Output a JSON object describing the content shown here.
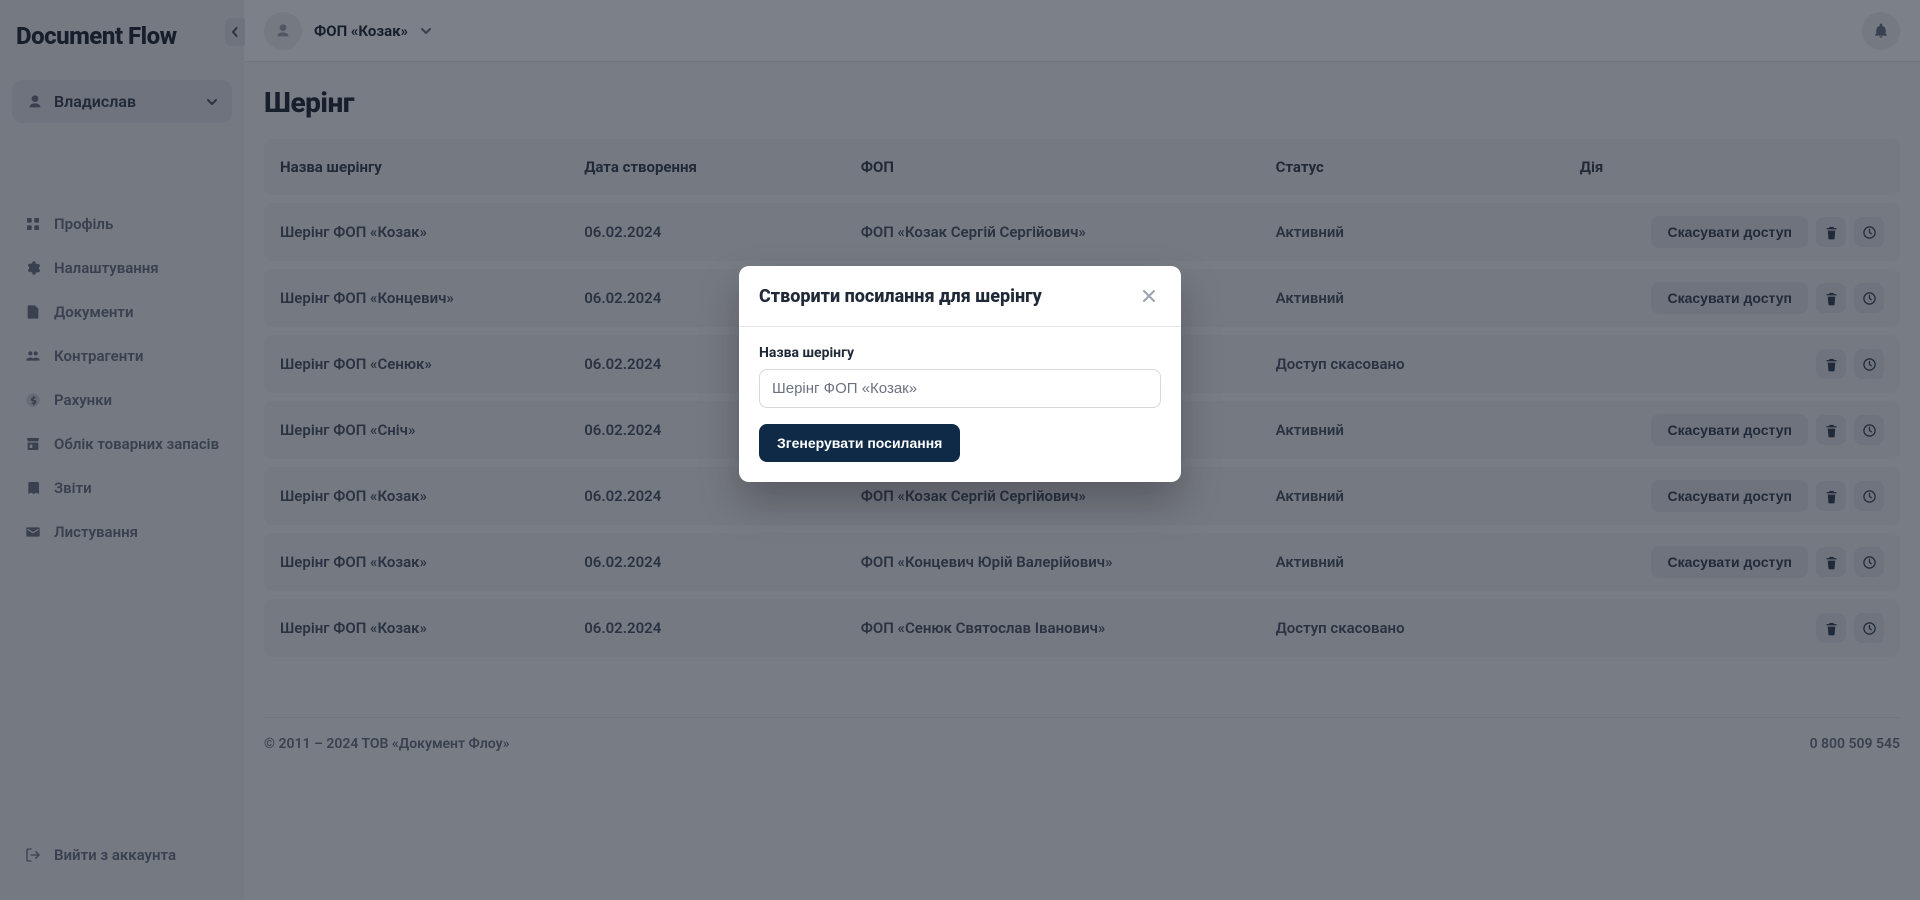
{
  "brand": "Document Flow",
  "user_switch": {
    "name": "Владислав"
  },
  "nav": {
    "items": [
      {
        "label": "Профіль"
      },
      {
        "label": "Налаштування"
      },
      {
        "label": "Документи"
      },
      {
        "label": "Контрагенти"
      },
      {
        "label": "Рахунки"
      },
      {
        "label": "Облік товарних запасів"
      },
      {
        "label": "Звіти"
      },
      {
        "label": "Листування"
      }
    ],
    "logout_label": "Вийти з аккаунта"
  },
  "topbar": {
    "org_name": "ФОП «Козак»"
  },
  "page": {
    "title": "Шерінг"
  },
  "table": {
    "headers": {
      "name": "Назва шерінгу",
      "date": "Дата створення",
      "fop": "ФОП",
      "status": "Статус",
      "action": "Дія"
    },
    "revoke_label": "Скасувати доступ",
    "rows": [
      {
        "name": "Шерінг ФОП «Козак»",
        "date": "06.02.2024",
        "fop": "ФОП «Козак Сергій Сергійович»",
        "status": "Активний",
        "revocable": true
      },
      {
        "name": "Шерінг ФОП «Концевич»",
        "date": "06.02.2024",
        "fop": "",
        "status": "Активний",
        "revocable": true
      },
      {
        "name": "Шерінг ФОП «Сенюк»",
        "date": "06.02.2024",
        "fop": "",
        "status": "Доступ скасовано",
        "revocable": false
      },
      {
        "name": "Шерінг ФОП «Сніч»",
        "date": "06.02.2024",
        "fop": "",
        "status": "Активний",
        "revocable": true
      },
      {
        "name": "Шерінг ФОП «Козак»",
        "date": "06.02.2024",
        "fop": "ФОП «Козак Сергій Сергійович»",
        "status": "Активний",
        "revocable": true
      },
      {
        "name": "Шерінг ФОП «Козак»",
        "date": "06.02.2024",
        "fop": "ФОП «Концевич Юрій Валерійович»",
        "status": "Активний",
        "revocable": true
      },
      {
        "name": "Шерінг ФОП «Козак»",
        "date": "06.02.2024",
        "fop": "ФОП «Сенюк Святослав Іванович»",
        "status": "Доступ скасовано",
        "revocable": false
      }
    ]
  },
  "footer": {
    "copyright": "© 2011 – 2024 ТОВ «Документ Флоу»",
    "phone": "0 800 509 545"
  },
  "modal": {
    "title": "Створити посилання для шерінгу",
    "field_label": "Назва шерінгу",
    "input_value": "Шерінг ФОП «Козак»",
    "submit_label": "Згенерувати посилання"
  }
}
